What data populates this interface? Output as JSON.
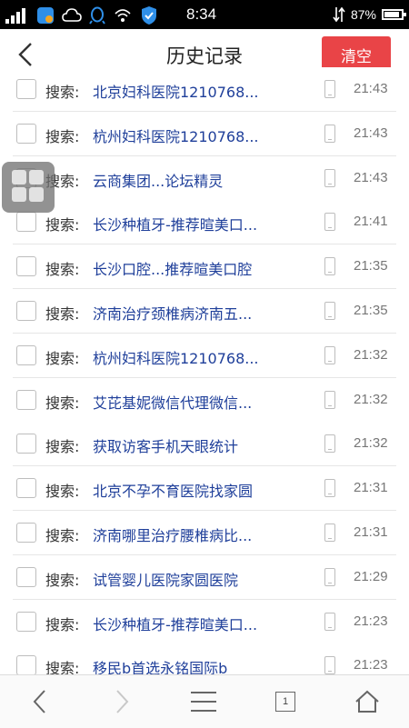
{
  "status_bar": {
    "time": "8:34",
    "battery_percent": "87%",
    "battery_level": 0.87,
    "icons": [
      "signal-icon",
      "app-notification-icon",
      "cloud-icon",
      "qq-icon",
      "wifi-icon",
      "shield-icon",
      "data-transfer-icon"
    ]
  },
  "nav": {
    "back_icon": "chevron-left-icon",
    "title": "历史记录",
    "clear_label": "清空",
    "clear_color": "#e94447"
  },
  "history": {
    "items": [
      {
        "label": "搜索:",
        "query": "北京妇科医院1210768...",
        "time": "21:43"
      },
      {
        "label": "搜索:",
        "query": "杭州妇科医院1210768...",
        "time": "21:43"
      },
      {
        "label": "搜索:",
        "query": "云商集团...论坛精灵",
        "time": "21:43"
      },
      {
        "label": "搜索:",
        "query": "长沙种植牙-推荐暄美口...",
        "time": "21:41"
      },
      {
        "label": "搜索:",
        "query": "长沙口腔...推荐暄美口腔",
        "time": "21:35"
      },
      {
        "label": "搜索:",
        "query": "济南治疗颈椎病济南五...",
        "time": "21:35"
      },
      {
        "label": "搜索:",
        "query": "杭州妇科医院1210768...",
        "time": "21:32"
      },
      {
        "label": "搜索:",
        "query": "艾芘基妮微信代理微信...",
        "time": "21:32"
      },
      {
        "label": "搜索:",
        "query": "获取访客手机天眼统计",
        "time": "21:32"
      },
      {
        "label": "搜索:",
        "query": "北京不孕不育医院找家圆",
        "time": "21:31"
      },
      {
        "label": "搜索:",
        "query": "济南哪里治疗腰椎病比...",
        "time": "21:31"
      },
      {
        "label": "搜索:",
        "query": "试管婴儿医院家圆医院",
        "time": "21:29"
      },
      {
        "label": "搜索:",
        "query": "长沙种植牙-推荐暄美口...",
        "time": "21:23"
      },
      {
        "label": "搜索:",
        "query": "移民b首选永铭国际b",
        "time": "21:23"
      }
    ]
  },
  "bottom_bar": {
    "tabs_count": "1",
    "icons": [
      "back-icon",
      "forward-icon",
      "menu-icon",
      "tabs-icon",
      "home-icon"
    ]
  },
  "colors": {
    "query_link": "#1f3f9a",
    "accent_red": "#e94447"
  }
}
